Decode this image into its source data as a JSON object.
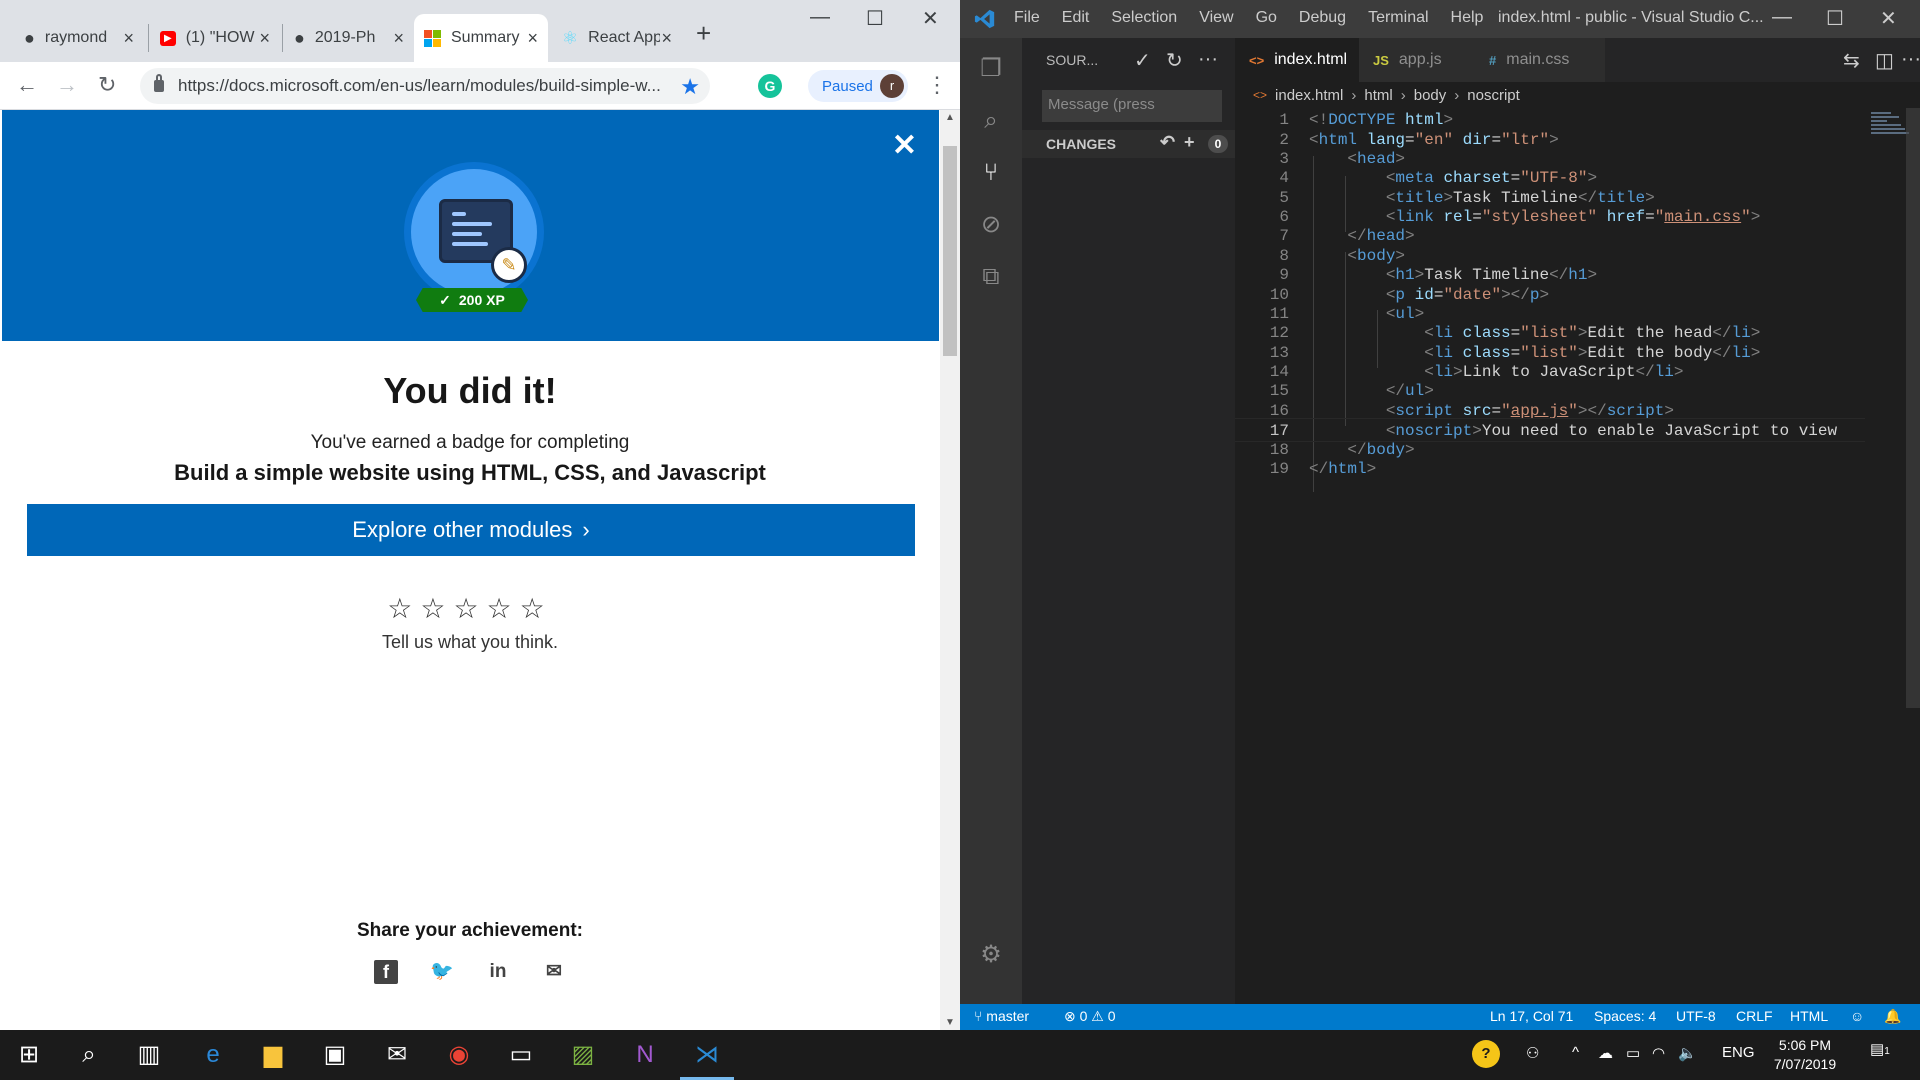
{
  "chrome": {
    "tabs": [
      {
        "title": "raymond",
        "icon": "github-icon"
      },
      {
        "title": "(1) \"HOW",
        "icon": "youtube-icon"
      },
      {
        "title": "2019-Ph",
        "icon": "github-icon"
      },
      {
        "title": "Summary",
        "icon": "microsoft-icon"
      },
      {
        "title": "React App",
        "icon": "react-icon"
      }
    ],
    "url": "https://docs.microsoft.com/en-us/learn/modules/build-simple-w...",
    "profile_status": "Paused",
    "profile_initial": "r"
  },
  "page": {
    "xp": "200 XP",
    "title": "You did it!",
    "earned": "You've earned a badge for completing",
    "module_name": "Build a simple website using HTML, CSS, and Javascript",
    "explore_label": "Explore other modules",
    "stars": "☆☆☆☆☆",
    "feedback": "Tell us what you think.",
    "share": "Share your achievement:"
  },
  "vscode": {
    "menu": [
      "File",
      "Edit",
      "Selection",
      "View",
      "Go",
      "Debug",
      "Terminal",
      "Help"
    ],
    "window_title": "index.html - public - Visual Studio C...",
    "sidebar_title": "SOUR...",
    "commit_placeholder": "Message (press",
    "changes_label": "CHANGES",
    "changes_count": "0",
    "editor_tabs": [
      {
        "name": "index.html",
        "icon": "<>",
        "color": "#e37933"
      },
      {
        "name": "app.js",
        "icon": "JS",
        "color": "#cbcb41"
      },
      {
        "name": "main.css",
        "icon": "#",
        "color": "#519aba"
      }
    ],
    "breadcrumb": [
      "index.html",
      "html",
      "body",
      "noscript"
    ],
    "status": {
      "branch": "master",
      "errors": "0",
      "warnings": "0",
      "position": "Ln 17, Col 71",
      "spaces": "Spaces: 4",
      "encoding": "UTF-8",
      "eol": "CRLF",
      "language": "HTML"
    }
  },
  "taskbar": {
    "language": "ENG",
    "time": "5:06 PM",
    "date": "7/07/2019",
    "notification_count": "1"
  }
}
